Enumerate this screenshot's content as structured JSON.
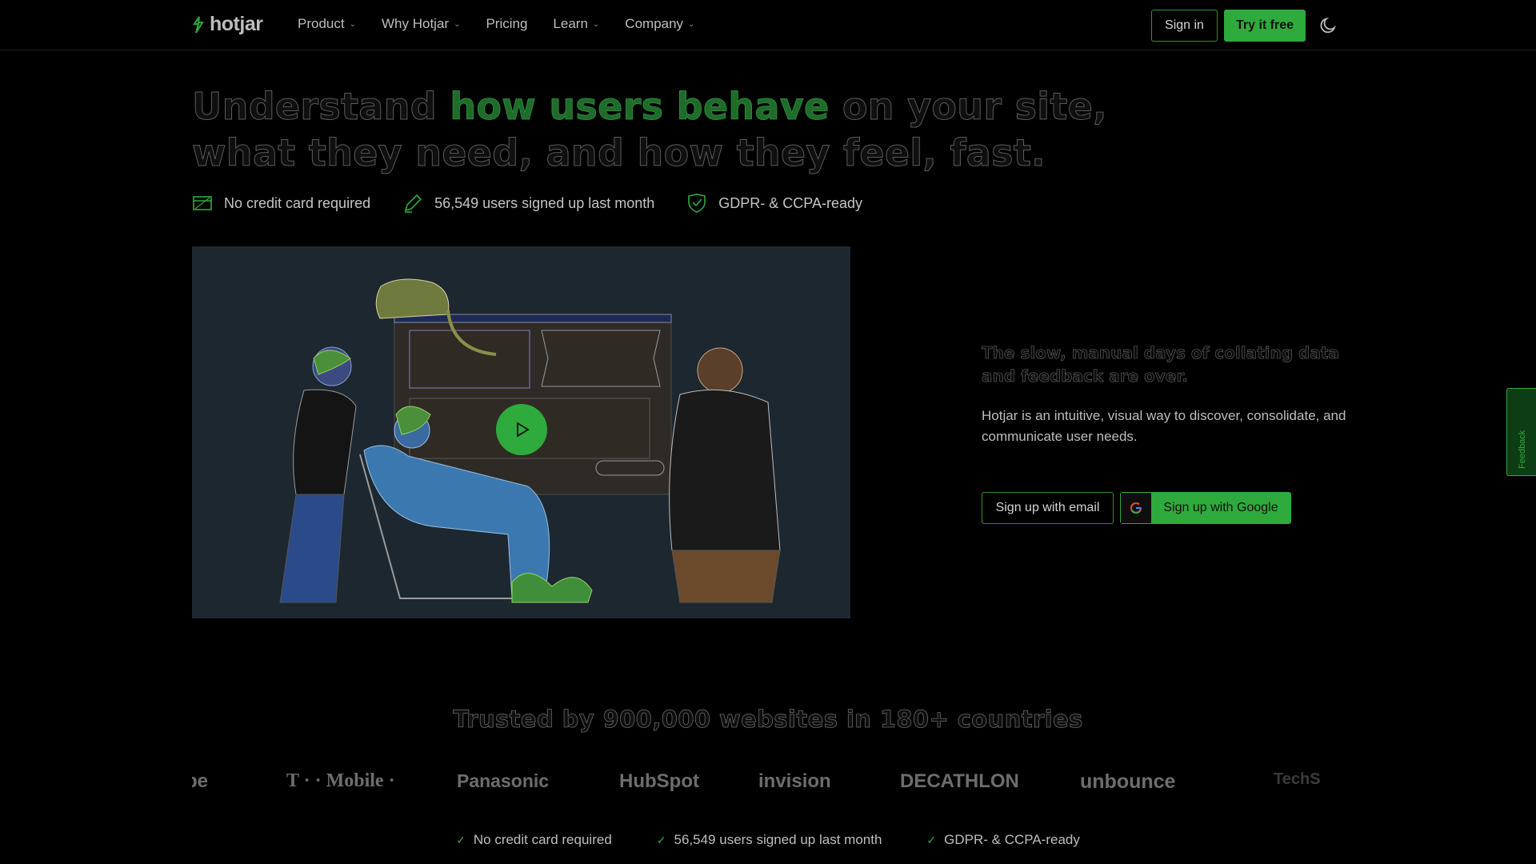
{
  "nav": {
    "logo_text": "hotjar",
    "links": [
      {
        "label": "Product",
        "has_dropdown": true
      },
      {
        "label": "Why Hotjar",
        "has_dropdown": true
      },
      {
        "label": "Pricing",
        "has_dropdown": false
      },
      {
        "label": "Learn",
        "has_dropdown": true
      },
      {
        "label": "Company",
        "has_dropdown": true
      }
    ],
    "signin_label": "Sign in",
    "try_label": "Try it free",
    "theme_icon": "moon-icon"
  },
  "hero": {
    "title_before": "Understand ",
    "title_accent": "how users behave",
    "title_after": " on your site, what they need, and how they feel, fast.",
    "features": [
      {
        "icon": "card-icon",
        "text": "No credit card required"
      },
      {
        "icon": "pencil-icon",
        "text": "56,549 users signed up last month"
      },
      {
        "icon": "shield-check-icon",
        "text": "GDPR- & CCPA-ready"
      }
    ]
  },
  "video": {
    "play_icon": "play-icon"
  },
  "side": {
    "heading": "The slow, manual days of collating data and feedback are over.",
    "body": "Hotjar is an intuitive, visual way to discover, consolidate, and communicate user needs.",
    "email_button": "Sign up with email",
    "google_button": "Sign up with Google"
  },
  "feedback_tab": {
    "label": "Feedback"
  },
  "trusted": {
    "heading": "Trusted by 900,000 websites in 180+ countries",
    "logos": [
      "be",
      "T · · Mobile ·",
      "Panasonic",
      "HubSpot",
      "invision",
      "DECATHLON",
      "unbounce",
      "TechS"
    ]
  },
  "bottom_features": [
    "No credit card required",
    "56,549 users signed up last month",
    "GDPR- & CCPA-ready"
  ],
  "colors": {
    "accent_green": "#2faa3c",
    "background": "#000000",
    "video_bg": "#1d2730"
  }
}
